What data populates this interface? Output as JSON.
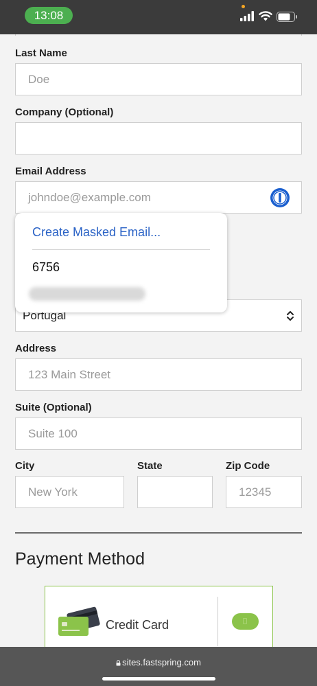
{
  "status_bar": {
    "time": "13:08"
  },
  "form": {
    "last_name": {
      "label": "Last Name",
      "placeholder": "Doe"
    },
    "company": {
      "label": "Company (Optional)",
      "placeholder": ""
    },
    "email": {
      "label": "Email Address",
      "placeholder": "johndoe@example.com"
    },
    "country": {
      "value": "Portugal"
    },
    "address": {
      "label": "Address",
      "placeholder": "123 Main Street"
    },
    "suite": {
      "label": "Suite (Optional)",
      "placeholder": "Suite 100"
    },
    "city": {
      "label": "City",
      "placeholder": "New York"
    },
    "state": {
      "label": "State",
      "placeholder": ""
    },
    "zip": {
      "label": "Zip Code",
      "placeholder": "12345"
    }
  },
  "autofill_popup": {
    "create_label": "Create Masked Email...",
    "suggestion_code": "6756"
  },
  "payment": {
    "title": "Payment Method",
    "credit_card_label": "Credit Card"
  },
  "browser": {
    "url": "sites.fastspring.com"
  },
  "colors": {
    "accent_green": "#8bc34a",
    "link_blue": "#2b63c6",
    "time_pill_green": "#4caf50"
  }
}
